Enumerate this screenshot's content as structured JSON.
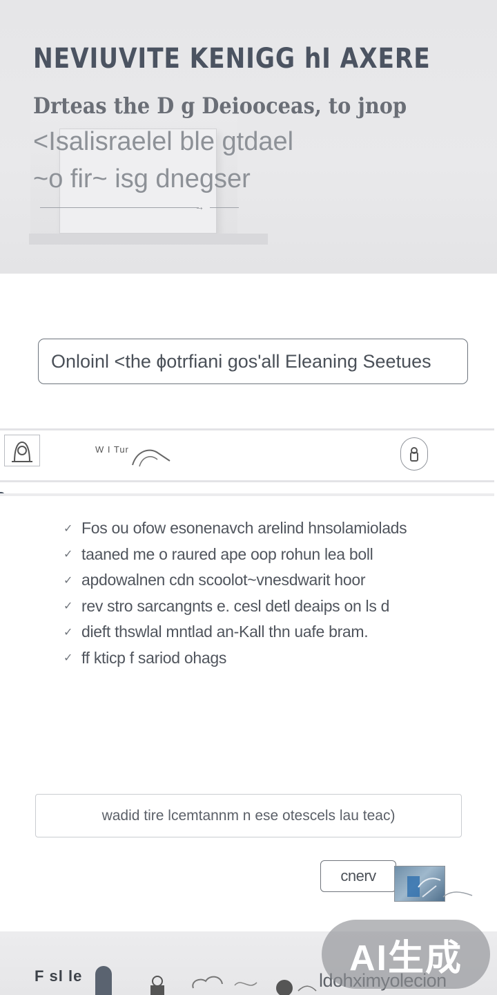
{
  "colors": {
    "accent": "#4a5563",
    "hero_bg": "#e7e7e9",
    "text": "#4b5361",
    "border": "#6c737c",
    "badge_bg": "#8a8c92"
  },
  "hero": {
    "title": "NEVIUVITE KENIGG hI AXERE",
    "subtitle": "Drteas the D g Deiooceas, to jnop",
    "line1": "<Isalisraelel ble gtdael",
    "line2": "~o fir~ isg dnegser"
  },
  "search": {
    "value": "",
    "placeholder": "Onloinl <the ɸotrfiani gos'all Eleaning Seetues"
  },
  "appbar": {
    "avatar_icon": "portrait-icon",
    "app_name": "W I Tur",
    "wave_icon": "wave-icon",
    "lock_icon": "lock-icon"
  },
  "checklist": {
    "items": [
      "Fos ou ofow esonenavch arelind hnsolamiolads",
      "taaned me o raured ape oop rohun lea boll",
      "apdowalnen cdn scoolot~vnesdwarit hoor",
      "rev stro sarcangnts e. cesl detl deaips on ls d",
      "dieft thswlal mntlad an-Kall thn uafe bram.",
      "ff kticp f sariod ohags"
    ]
  },
  "info_box": {
    "text": "wadid tire lcemtannm n ese otescels lau teac)"
  },
  "action": {
    "button_label": "cnerv",
    "thumbnail": "image-thumbnail"
  },
  "bottombar": {
    "label": "F sl le",
    "trailing_text": "ldohximyolecion"
  },
  "badge": {
    "text": "AI生成"
  }
}
